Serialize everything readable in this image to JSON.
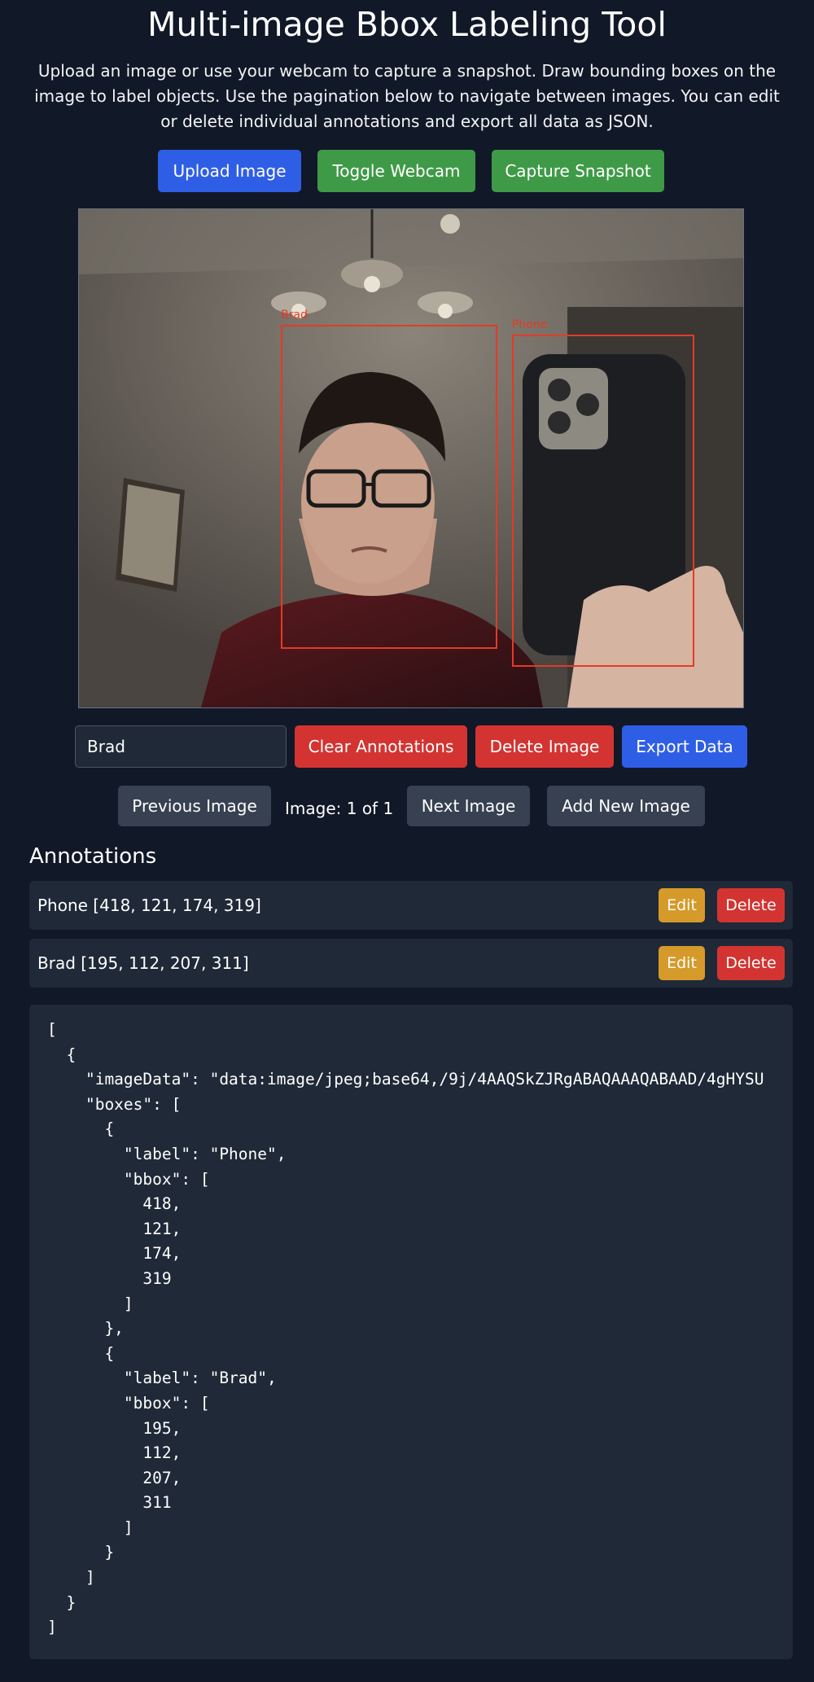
{
  "page": {
    "title": "Multi-image Bbox Labeling Tool",
    "description": "Upload an image or use your webcam to capture a snapshot. Draw bounding boxes on the image to label objects. Use the pagination below to navigate between images. You can edit or delete individual annotations and export all data as JSON."
  },
  "toolbar": {
    "upload_label": "Upload Image",
    "webcam_label": "Toggle Webcam",
    "snapshot_label": "Capture Snapshot"
  },
  "canvas": {
    "boxes": [
      {
        "label": "Brad"
      },
      {
        "label": "Phone"
      }
    ]
  },
  "controls": {
    "label_input_value": "Brad",
    "clear_label": "Clear Annotations",
    "delete_image_label": "Delete Image",
    "export_label": "Export Data"
  },
  "pagination": {
    "prev_label": "Previous Image",
    "counter": "Image: 1 of 1",
    "next_label": "Next Image",
    "add_label": "Add New Image"
  },
  "annotations": {
    "title": "Annotations",
    "edit_label": "Edit",
    "delete_label": "Delete",
    "items": [
      {
        "text": "Phone [418, 121, 174, 319]"
      },
      {
        "text": "Brad [195, 112, 207, 311]"
      }
    ]
  },
  "json_output": "[\n  {\n    \"imageData\": \"data:image/jpeg;base64,/9j/4AAQSkZJRgABAQAAAQABAAD/4gHYSU\n    \"boxes\": [\n      {\n        \"label\": \"Phone\",\n        \"bbox\": [\n          418,\n          121,\n          174,\n          319\n        ]\n      },\n      {\n        \"label\": \"Brad\",\n        \"bbox\": [\n          195,\n          112,\n          207,\n          311\n        ]\n      }\n    ]\n  }\n]",
  "colors": {
    "background": "#111827",
    "panel": "#1f2937",
    "primary": "#2f5ee6",
    "success": "#3f9a47",
    "danger": "#d33431",
    "warning": "#d69a2a",
    "bbox": "#e43a26"
  }
}
